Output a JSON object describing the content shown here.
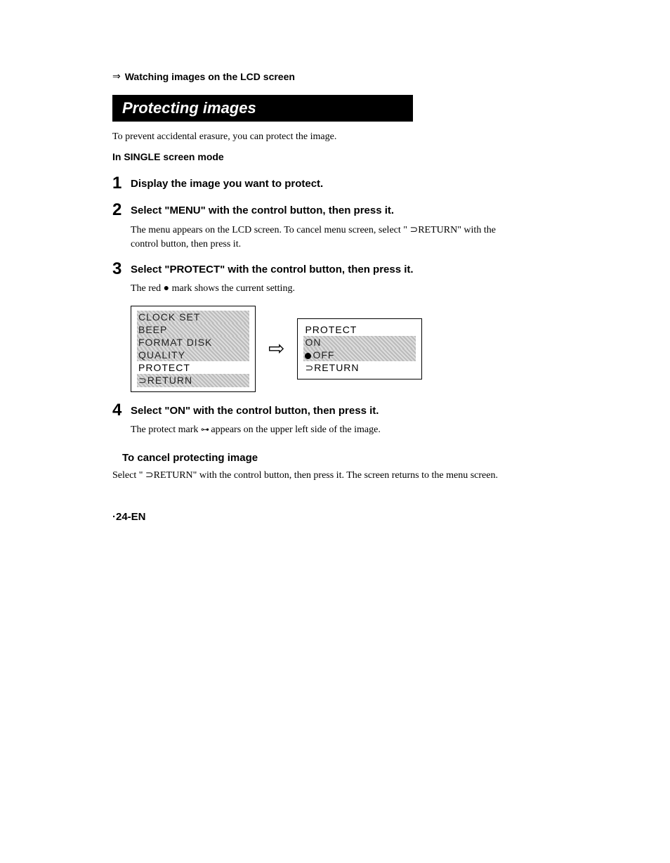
{
  "breadcrumb": {
    "arrow": "⇒",
    "text": "Watching images on the LCD screen"
  },
  "section_title": "Protecting images",
  "intro": "To prevent accidental erasure, you can protect the image.",
  "mode": "In SINGLE screen mode",
  "steps": [
    {
      "num": "1",
      "title": "Display the image you want to protect."
    },
    {
      "num": "2",
      "title": "Select \"MENU\" with the control button, then press it.",
      "body_pre": "The menu appears on the LCD screen. To cancel menu screen, select \" ",
      "body_glyph": "⊃",
      "body_post": "RETURN\" with the control button, then press it."
    },
    {
      "num": "3",
      "title": "Select \"PROTECT\" with the control button, then press it.",
      "body": "The red ● mark shows the current setting."
    },
    {
      "num": "4",
      "title": "Select \"ON\" with the control button, then press it.",
      "body_pre": "The protect mark ",
      "body_icon": "⊶",
      "body_post": " appears on the upper left side of the image."
    }
  ],
  "screens": {
    "left": {
      "rows": [
        {
          "text": "CLOCK SET",
          "hl": true
        },
        {
          "text": "BEEP",
          "hl": true
        },
        {
          "text": "FORMAT DISK",
          "hl": true
        },
        {
          "text": "QUALITY",
          "hl": true
        },
        {
          "text": "PROTECT",
          "hl": false
        },
        {
          "text": "⊃RETURN",
          "hl": true
        }
      ]
    },
    "arrow": "⇨",
    "right": {
      "rows": [
        {
          "text": "PROTECT",
          "hl": false
        },
        {
          "text": "  ON",
          "hl": true,
          "indent": true
        },
        {
          "text": "OFF",
          "hl": true,
          "dot": true
        },
        {
          "text": "⊃RETURN",
          "hl": false
        }
      ]
    }
  },
  "cancel": {
    "heading": "To cancel protecting image",
    "body_pre": "Select \" ",
    "body_glyph": "⊃",
    "body_post": "RETURN\" with the control button, then press it. The screen returns to the menu screen."
  },
  "page_num": "·24-EN"
}
